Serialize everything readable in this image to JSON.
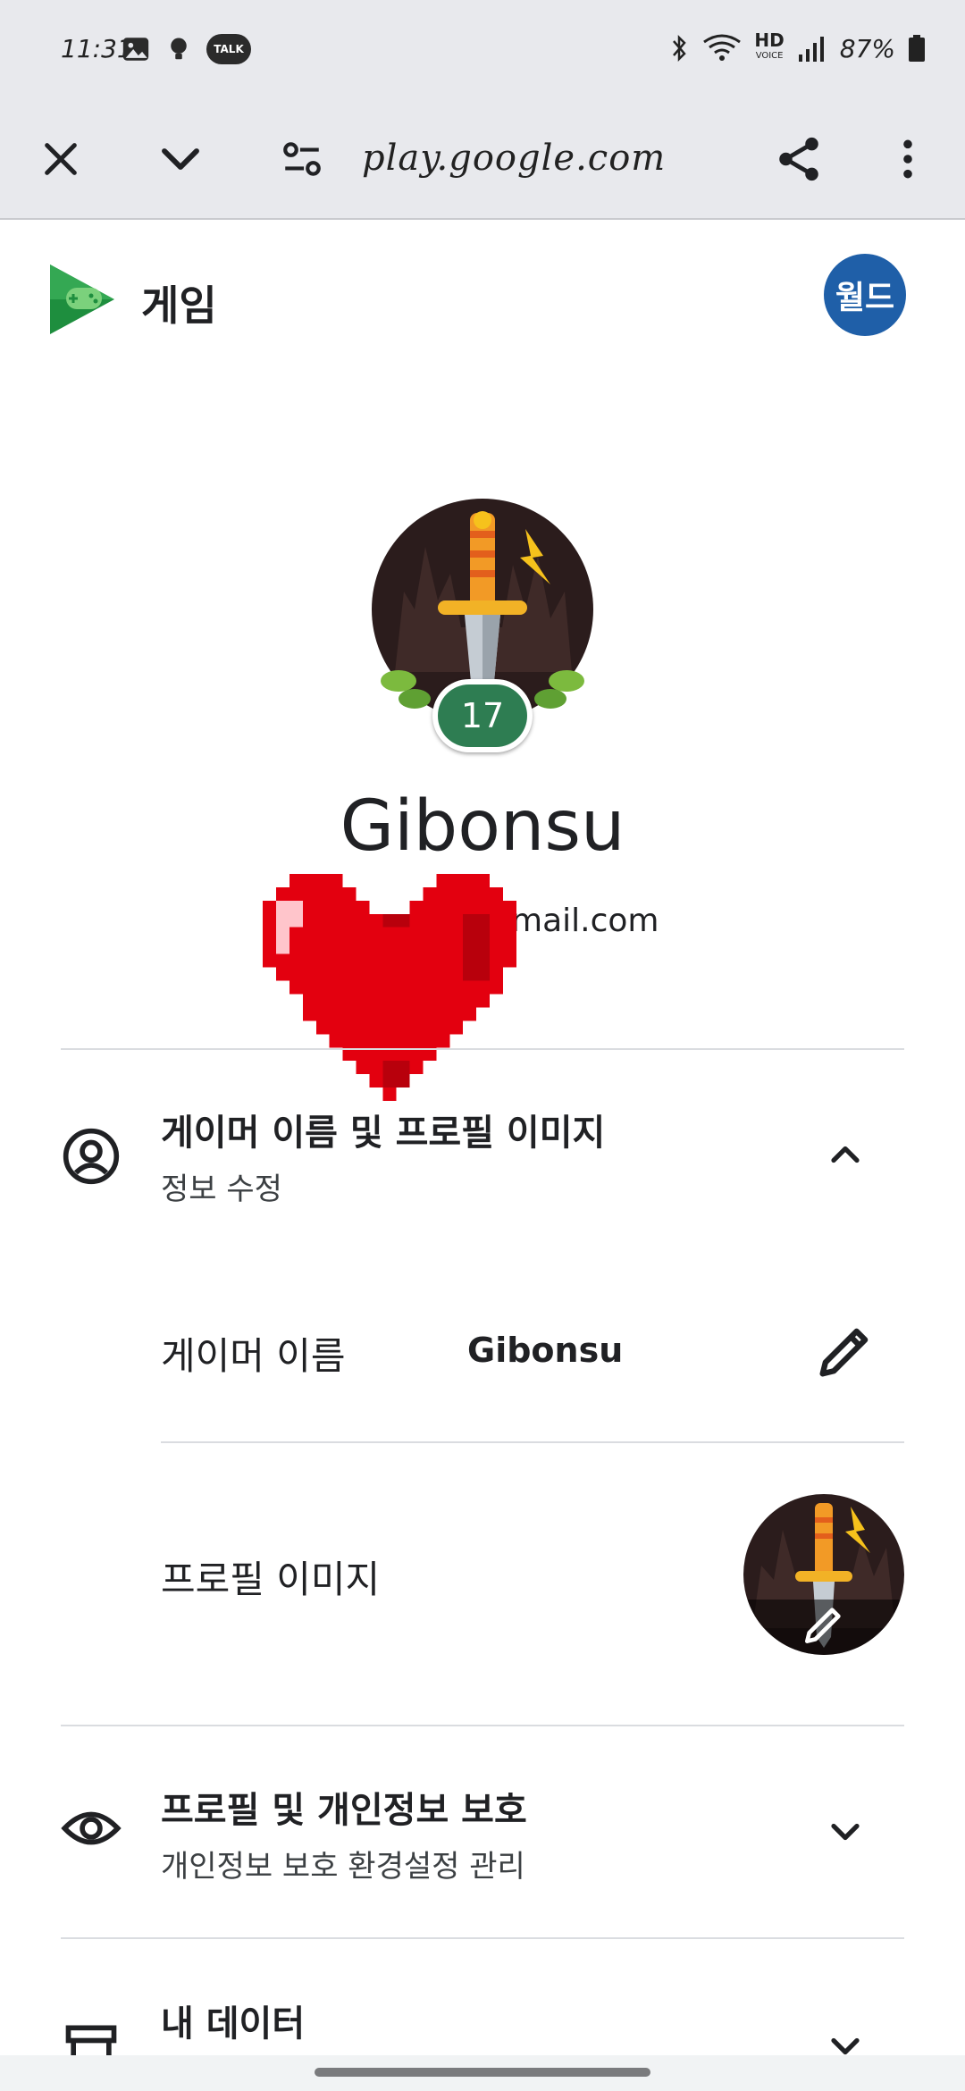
{
  "status_bar": {
    "time": "11:31",
    "hd_label": "HD",
    "voice_label": "VOICE",
    "battery": "87%",
    "talk_label": "TALK"
  },
  "browser": {
    "url": "play.google.com"
  },
  "app": {
    "title": "게임",
    "avatar_text": "월드"
  },
  "profile": {
    "level": "17",
    "name": "Gibonsu",
    "email_visible": "mail.com"
  },
  "sections": {
    "gamer": {
      "title": "게이머 이름 및 프로필 이미지",
      "subtitle": "정보 수정",
      "fields": {
        "name_label": "게이머 이름",
        "name_value": "Gibonsu",
        "image_label": "프로필 이미지"
      }
    },
    "privacy": {
      "title": "프로필 및 개인정보 보호",
      "subtitle": "개인정보 보호 환경설정 관리"
    },
    "data": {
      "title": "내 데이터"
    }
  },
  "colors": {
    "accent_green": "#2e7d52",
    "avatar_blue": "#1f5fa8",
    "heart_red": "#e3000f"
  }
}
